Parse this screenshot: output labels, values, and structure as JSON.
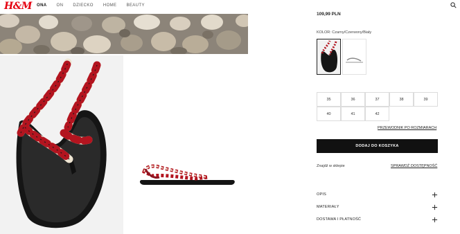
{
  "header": {
    "logo": "H&M",
    "nav": [
      "ONA",
      "ON",
      "DZIECKO",
      "HOME",
      "BEAUTY"
    ],
    "active_nav": "ONA",
    "search_icon": "search-icon"
  },
  "product": {
    "price": "109,99 PLN",
    "color_label": "KOLOR: Czarny/Czerwony/Biały",
    "sizes": [
      "35",
      "36",
      "37",
      "38",
      "39",
      "40",
      "41",
      "42"
    ],
    "size_guide": "PRZEWODNIK PO ROZMIARACH",
    "add_to_bag": "DODAJ DO KOSZYKA",
    "find_in_store": "Znajdź w sklepie",
    "check_availability": "SPRAWDŹ DOSTĘPNOŚĆ"
  },
  "accordion": [
    {
      "label": "OPIS",
      "icon": "plus-icon"
    },
    {
      "label": "MATERIAŁY",
      "icon": "plus-icon"
    },
    {
      "label": "DOSTAWA I PŁATNOŚĆ",
      "icon": "plus-icon"
    }
  ],
  "colors": {
    "brand_red": "#e50010",
    "button_black": "#111111",
    "rope_red": "#b3141f",
    "rope_cream": "#eee4d2"
  }
}
